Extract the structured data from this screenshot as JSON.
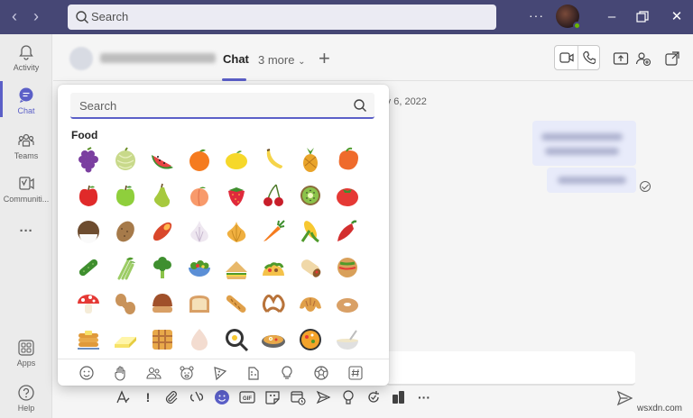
{
  "titlebar": {
    "search_placeholder": "Search",
    "more_label": "···",
    "accent": "#464775"
  },
  "rail": {
    "items": [
      {
        "label": "Activity",
        "icon": "bell-icon"
      },
      {
        "label": "Chat",
        "icon": "chat-icon",
        "active": true
      },
      {
        "label": "Teams",
        "icon": "teams-icon"
      },
      {
        "label": "Communiti...",
        "icon": "viva-engage-icon"
      },
      {
        "label": "···",
        "icon": "more-apps-icon"
      },
      {
        "label": "Apps",
        "icon": "apps-icon"
      },
      {
        "label": "Help",
        "icon": "help-icon"
      }
    ]
  },
  "chat_header": {
    "tab_chat": "Chat",
    "tab_more": "3 more",
    "add_tab": "+"
  },
  "messages": {
    "date_fragment": "ry 6, 2022"
  },
  "emoji_picker": {
    "search_placeholder": "Search",
    "category": "Food",
    "emojis": [
      [
        "grapes",
        "melon",
        "watermelon",
        "tangerine",
        "lemon",
        "banana",
        "pineapple",
        "mango"
      ],
      [
        "red-apple",
        "green-apple",
        "pear",
        "peach",
        "strawberry",
        "cherries",
        "kiwi",
        "tomato"
      ],
      [
        "coconut",
        "potato",
        "sweet-potato",
        "garlic",
        "onion",
        "carrot",
        "corn",
        "hot-pepper"
      ],
      [
        "cucumber",
        "celery",
        "broccoli",
        "salad",
        "sandwich",
        "taco",
        "burrito",
        "stuffed-flatbread"
      ],
      [
        "mushroom",
        "peanuts",
        "chestnut",
        "bread",
        "baguette",
        "pretzel",
        "croissant",
        "bagel"
      ],
      [
        "pancakes",
        "butter",
        "waffle",
        "egg",
        "cooking",
        "shallow-pan-of-food",
        "paella",
        "bowl-with-spoon"
      ]
    ],
    "category_tabs": [
      "smileys-icon",
      "hand-icon",
      "people-icon",
      "animal-icon",
      "food-icon",
      "travel-icon",
      "activity-icon",
      "objects-icon",
      "symbols-icon"
    ]
  },
  "watermark": "wsxdn.com",
  "colors": {
    "brand": "#5b5fc7",
    "titlebar": "#464775"
  }
}
